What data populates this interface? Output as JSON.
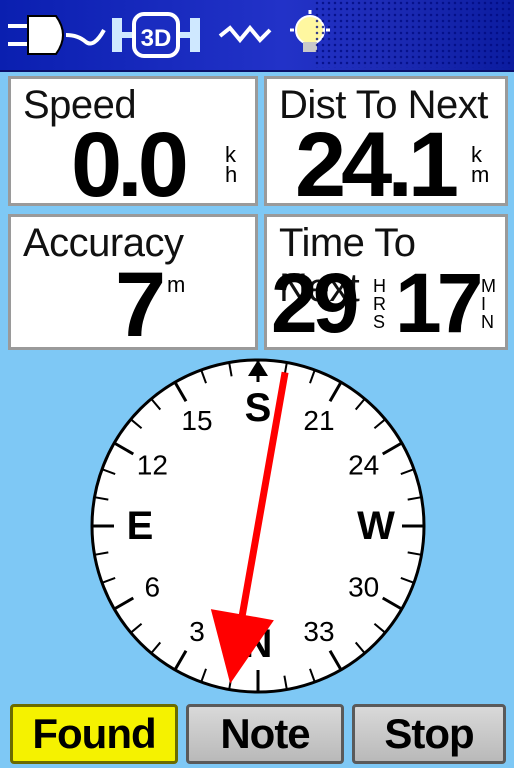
{
  "colors": {
    "statusbar": "#1a2cc0",
    "background": "#7ec8f5",
    "field_bg": "#ffffff",
    "button_selected": "#f5f200",
    "button_normal": "#c4c4c4",
    "arrow": "#ff0000"
  },
  "statusbar": {
    "power_icon": "power-plug-icon",
    "gps_fix_icon": "satellite-3d-fix-icon",
    "gps_fix_label": "3D",
    "signal_icon": "signal-waves-icon",
    "backlight_icon": "backlight-bulb-icon"
  },
  "fields": {
    "speed": {
      "label": "Speed",
      "value": "0.0",
      "unit_top": "k",
      "unit_bottom": "h"
    },
    "dist_to_next": {
      "label": "Dist To Next",
      "value": "24.1",
      "unit_top": "k",
      "unit_bottom": "m"
    },
    "accuracy": {
      "label": "Accuracy",
      "value": "7",
      "unit_top": "m",
      "unit_bottom": ""
    },
    "time_to_next": {
      "label": "Time To Next",
      "hours": "29",
      "hours_unit": [
        "H",
        "R",
        "S"
      ],
      "minutes": "17",
      "minutes_unit": [
        "M",
        "I",
        "N"
      ]
    }
  },
  "compass": {
    "bearing_deg": 190,
    "heading_deg": 180,
    "labels": [
      {
        "text": "N",
        "deg": 0,
        "cardinal": true
      },
      {
        "text": "3",
        "deg": 30,
        "cardinal": false
      },
      {
        "text": "6",
        "deg": 60,
        "cardinal": false
      },
      {
        "text": "E",
        "deg": 90,
        "cardinal": true
      },
      {
        "text": "12",
        "deg": 120,
        "cardinal": false
      },
      {
        "text": "15",
        "deg": 150,
        "cardinal": false
      },
      {
        "text": "S",
        "deg": 180,
        "cardinal": true
      },
      {
        "text": "21",
        "deg": 210,
        "cardinal": false
      },
      {
        "text": "24",
        "deg": 240,
        "cardinal": false
      },
      {
        "text": "W",
        "deg": 270,
        "cardinal": true
      },
      {
        "text": "30",
        "deg": 300,
        "cardinal": false
      },
      {
        "text": "33",
        "deg": 330,
        "cardinal": false
      }
    ]
  },
  "buttons": {
    "found": "Found",
    "note": "Note",
    "stop": "Stop"
  }
}
